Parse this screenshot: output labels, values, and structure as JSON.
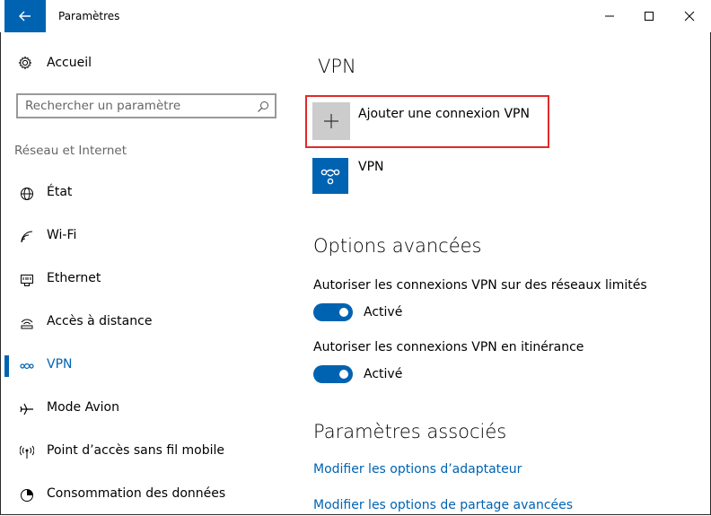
{
  "window": {
    "title": "Paramètres"
  },
  "sidebar": {
    "home_label": "Accueil",
    "search_placeholder": "Rechercher un paramètre",
    "section_label": "Réseau et Internet",
    "items": [
      {
        "label": "État",
        "icon": "globe-icon"
      },
      {
        "label": "Wi-Fi",
        "icon": "wifi-icon"
      },
      {
        "label": "Ethernet",
        "icon": "ethernet-icon"
      },
      {
        "label": "Accès à distance",
        "icon": "dialup-icon"
      },
      {
        "label": "VPN",
        "icon": "vpn-icon",
        "active": true
      },
      {
        "label": "Mode Avion",
        "icon": "airplane-icon"
      },
      {
        "label": "Point d’accès sans fil mobile",
        "icon": "hotspot-icon"
      },
      {
        "label": "Consommation des données",
        "icon": "data-usage-icon"
      }
    ]
  },
  "main": {
    "title": "VPN",
    "add_connection_label": "Ajouter une connexion VPN",
    "vpn_connection_label": "VPN",
    "advanced": {
      "title": "Options avancées",
      "options": [
        {
          "label": "Autoriser les connexions VPN sur des réseaux limités",
          "state": "Activé",
          "on": true
        },
        {
          "label": "Autoriser les connexions VPN en itinérance",
          "state": "Activé",
          "on": true
        }
      ]
    },
    "related": {
      "title": "Paramètres associés",
      "links": [
        "Modifier les options d’adaptateur",
        "Modifier les options de partage avancées"
      ]
    }
  },
  "colors": {
    "accent": "#0063b1",
    "highlight_border": "#e12a2a",
    "tile_gray": "#cccccc"
  }
}
